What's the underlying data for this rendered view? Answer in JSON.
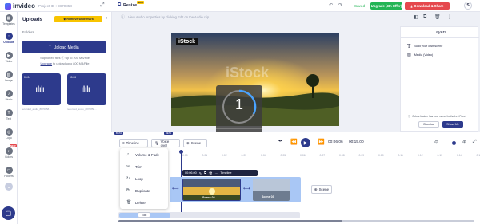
{
  "topbar": {
    "brand": "invideo",
    "project_id": "Project ID : 8870858",
    "resize_label": "Resize",
    "resize_badge": "NEW",
    "saved": "Saved",
    "upgrade": "Upgrade (4th Offer)",
    "download": "Download & Share",
    "user_initial": "S"
  },
  "rail": {
    "items": [
      {
        "label": "Templates",
        "icon": "grid-icon"
      },
      {
        "label": "Uploads",
        "icon": "upload-icon"
      },
      {
        "label": "Video",
        "icon": "video-icon"
      },
      {
        "label": "Image",
        "icon": "image-icon"
      },
      {
        "label": "Music",
        "icon": "music-icon"
      },
      {
        "label": "Text",
        "icon": "text-icon"
      },
      {
        "label": "Logo",
        "icon": "logo-icon"
      },
      {
        "label": "Colors",
        "icon": "colors-icon",
        "badge": "NEW"
      },
      {
        "label": "Folders",
        "icon": "folder-icon"
      }
    ],
    "more_icon": "chevron-down-icon",
    "chat_icon": "chat-icon"
  },
  "uploads": {
    "title": "Uploads",
    "remove_watermark": "Remove Watermark",
    "folders": "Folders",
    "upload_button": "Upload Media",
    "supported": "Supported files",
    "limit": "Up to 200 MB/File",
    "upgrade_link": "Upgrade",
    "upgrade_rest": "to upload upto 800 MB/File",
    "audio_items": [
      {
        "duration": "00:04",
        "name": "recorded_audio_8870858..."
      },
      {
        "duration": "00:06",
        "name": "recorded_audio_8870858..."
      }
    ]
  },
  "toolbar_hint": "View Audio properties by clicking Edit on the Audio clip.",
  "preview": {
    "istock": "iStock",
    "watermark": "iStock",
    "countdown": "1",
    "cancel": "Cancel"
  },
  "layers": {
    "title": "Layers",
    "items": [
      {
        "label": "Build your own scene",
        "icon": "text-icon"
      },
      {
        "label": "Media (Video)",
        "icon": "image-icon"
      }
    ],
    "notice": "Colors feature has now moved to the Left Panel",
    "dismiss": "Dismiss",
    "show_me": "Show Me"
  },
  "timeline": {
    "badge_left": "BETA",
    "badge_mid": "BETA",
    "tabs": {
      "timeline": "Timeline",
      "voiceover": "Voice over",
      "scene": "Scene"
    },
    "time_current": "00:06.06",
    "time_total": "00:15.00",
    "ruler": [
      "0:00",
      "0:01",
      "0:02",
      "0:03",
      "0:04",
      "0:05",
      "0:06",
      "0:07",
      "0:08",
      "0:09",
      "0:10",
      "0:11",
      "0:12",
      "0:13",
      "0:14",
      "0:15"
    ],
    "clip_time": "00:06.00",
    "clip_timeline": "Timeline",
    "scene_02": "Scene 02",
    "scene_03": "Scene 03",
    "add_scene": "Scene",
    "edit_label": "Edit",
    "context_menu": [
      {
        "label": "Volume & Fade",
        "icon": "volume-icon"
      },
      {
        "label": "Trim",
        "icon": "trim-icon"
      },
      {
        "label": "Loop",
        "icon": "loop-icon"
      },
      {
        "label": "Duplicate",
        "icon": "duplicate-icon"
      },
      {
        "label": "Delete",
        "icon": "delete-icon"
      }
    ]
  },
  "colors": {
    "brand_blue": "#2d3a8c",
    "green": "#22b455",
    "red": "#e5484d",
    "yellow": "#f8c400",
    "scene_blue": "#a9c7f5"
  }
}
